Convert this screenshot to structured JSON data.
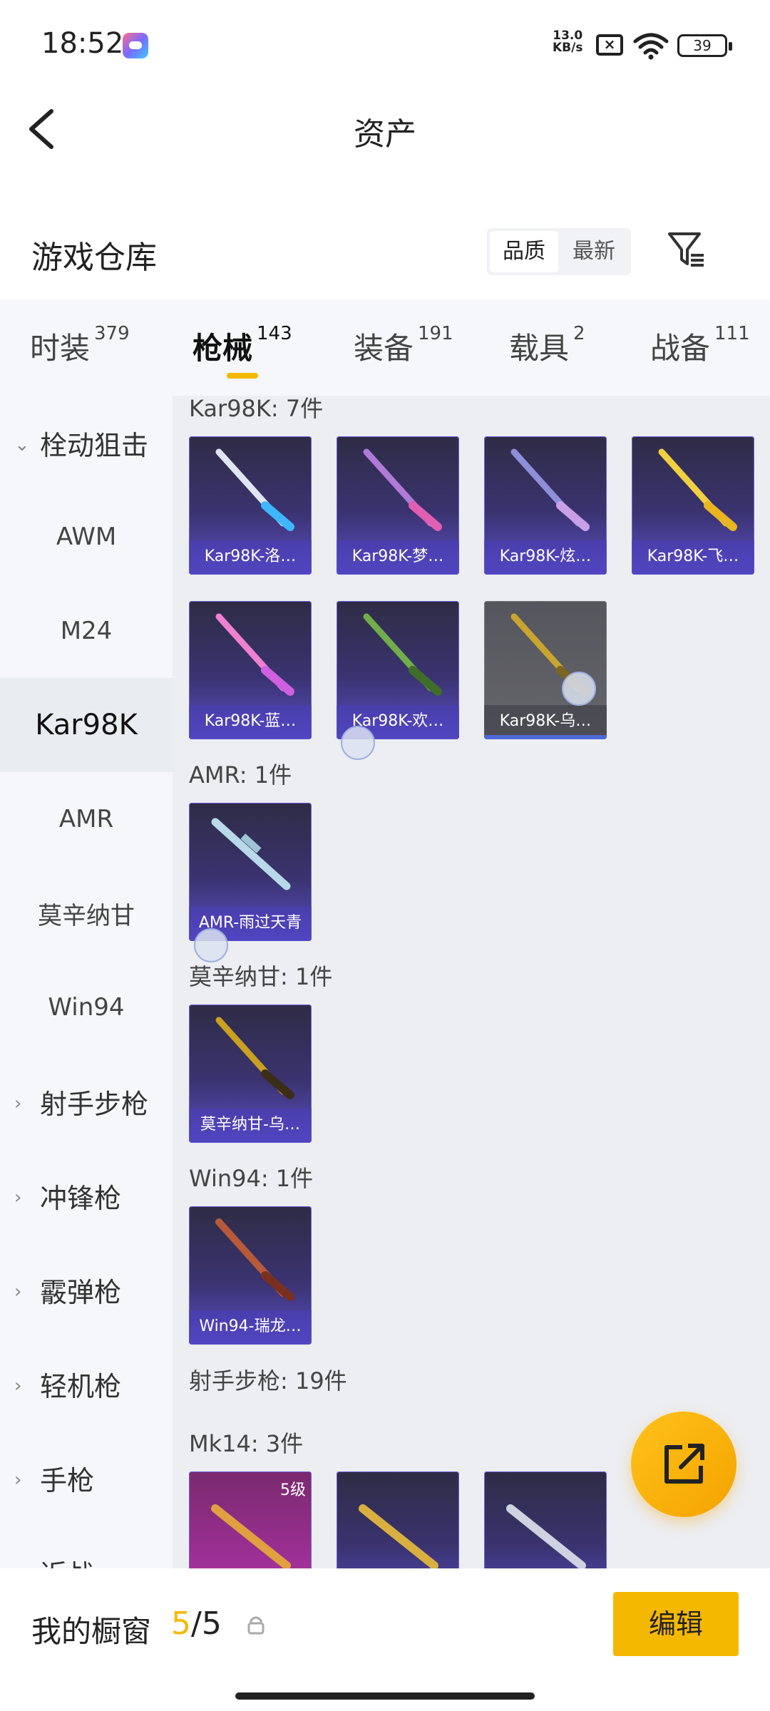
{
  "status": {
    "time": "18:52",
    "net_speed_value": "13.0",
    "net_speed_unit": "KB/s",
    "battery": "39"
  },
  "header": {
    "title": "资产"
  },
  "warehouse": {
    "title": "游戏仓库",
    "sort_quality": "品质",
    "sort_newest": "最新"
  },
  "tabs": [
    {
      "label": "时装",
      "count": "379"
    },
    {
      "label": "枪械",
      "count": "143"
    },
    {
      "label": "装备",
      "count": "191"
    },
    {
      "label": "载具",
      "count": "2"
    },
    {
      "label": "战备",
      "count": "111"
    }
  ],
  "sidebar": {
    "group1": "栓动狙击",
    "items": [
      "AWM",
      "M24",
      "Kar98K",
      "AMR",
      "莫辛纳甘",
      "Win94"
    ],
    "groups": [
      "射手步枪",
      "冲锋枪",
      "霰弹枪",
      "轻机枪",
      "手枪",
      "近战"
    ]
  },
  "sections": {
    "kar98k": "Kar98K: 7件",
    "amr": "AMR: 1件",
    "mosin": "莫辛纳甘: 1件",
    "win94": "Win94: 1件",
    "dmr": "射手步枪: 19件",
    "mk14": "Mk14: 3件"
  },
  "cards": {
    "k1": "Kar98K-洛…",
    "k2": "Kar98K-梦…",
    "k3": "Kar98K-炫…",
    "k4": "Kar98K-飞…",
    "k5": "Kar98K-蓝…",
    "k6": "Kar98K-欢…",
    "k7": "Kar98K-乌…",
    "amr1": "AMR-雨过天青",
    "mosin1": "莫辛纳甘-乌…",
    "win1": "Win94-瑞龙…",
    "mk14_level": "5级"
  },
  "bottom": {
    "label": "我的橱窗",
    "current": "5",
    "total": "/5",
    "edit": "编辑"
  },
  "colors": {
    "accent": "#f5b800",
    "card_purple": "#5b4fc6"
  }
}
